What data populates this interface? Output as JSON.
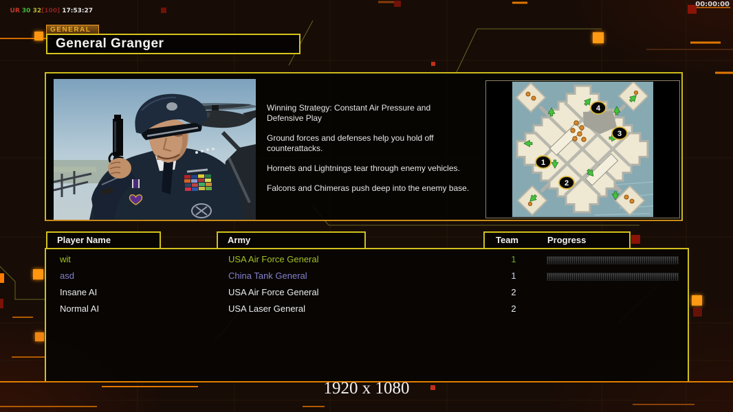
{
  "debug_overlay": {
    "tokens": [
      {
        "text": "UR ",
        "color": "#c43a2c"
      },
      {
        "text": "30 ",
        "color": "#3dbd3d"
      },
      {
        "text": "32",
        "color": "#b8b832"
      },
      {
        "text": "[100] ",
        "color": "#8a2020"
      },
      {
        "text": "17:53:27",
        "color": "#e6e6e6"
      }
    ]
  },
  "clock": {
    "elapsed": "00:00:00"
  },
  "header": {
    "tag": "GENERAL",
    "title": "General Granger"
  },
  "briefing": {
    "p1": "Winning Strategy: Constant Air Pressure and\nDefensive Play",
    "p2": "Ground forces and defenses help you hold off\ncounterattacks.",
    "p3": "Hornets and Lightnings tear through enemy vehicles.",
    "p4": "Falcons and Chimeras push deep into the enemy base."
  },
  "map": {
    "markers": [
      {
        "label": "1"
      },
      {
        "label": "2"
      },
      {
        "label": "3"
      },
      {
        "label": "4"
      }
    ]
  },
  "roster": {
    "headers": {
      "player": "Player Name",
      "army": "Army",
      "team": "Team",
      "progress": "Progress"
    },
    "players": [
      {
        "name": "wit",
        "army": "USA Air Force General",
        "team": "1",
        "color": "#a6c024",
        "team_color": "#6fae28"
      },
      {
        "name": "asd",
        "army": "China Tank General",
        "team": "1",
        "color": "#8580cb",
        "team_color": "#d2d2e6"
      },
      {
        "name": "Insane AI",
        "army": "USA Air Force General",
        "team": "2",
        "color": "#ececec",
        "team_color": "#ececec"
      },
      {
        "name": "Normal AI",
        "army": "USA Laser General",
        "team": "2",
        "color": "#ececec",
        "team_color": "#ececec"
      }
    ]
  },
  "watermark": "1920 x 1080",
  "colors": {
    "accent_yellow": "#d2c11c",
    "accent_orange": "#e07f00",
    "tag_orange": "#ef9d22",
    "loading_bar_tick": "#3c3c3c"
  }
}
